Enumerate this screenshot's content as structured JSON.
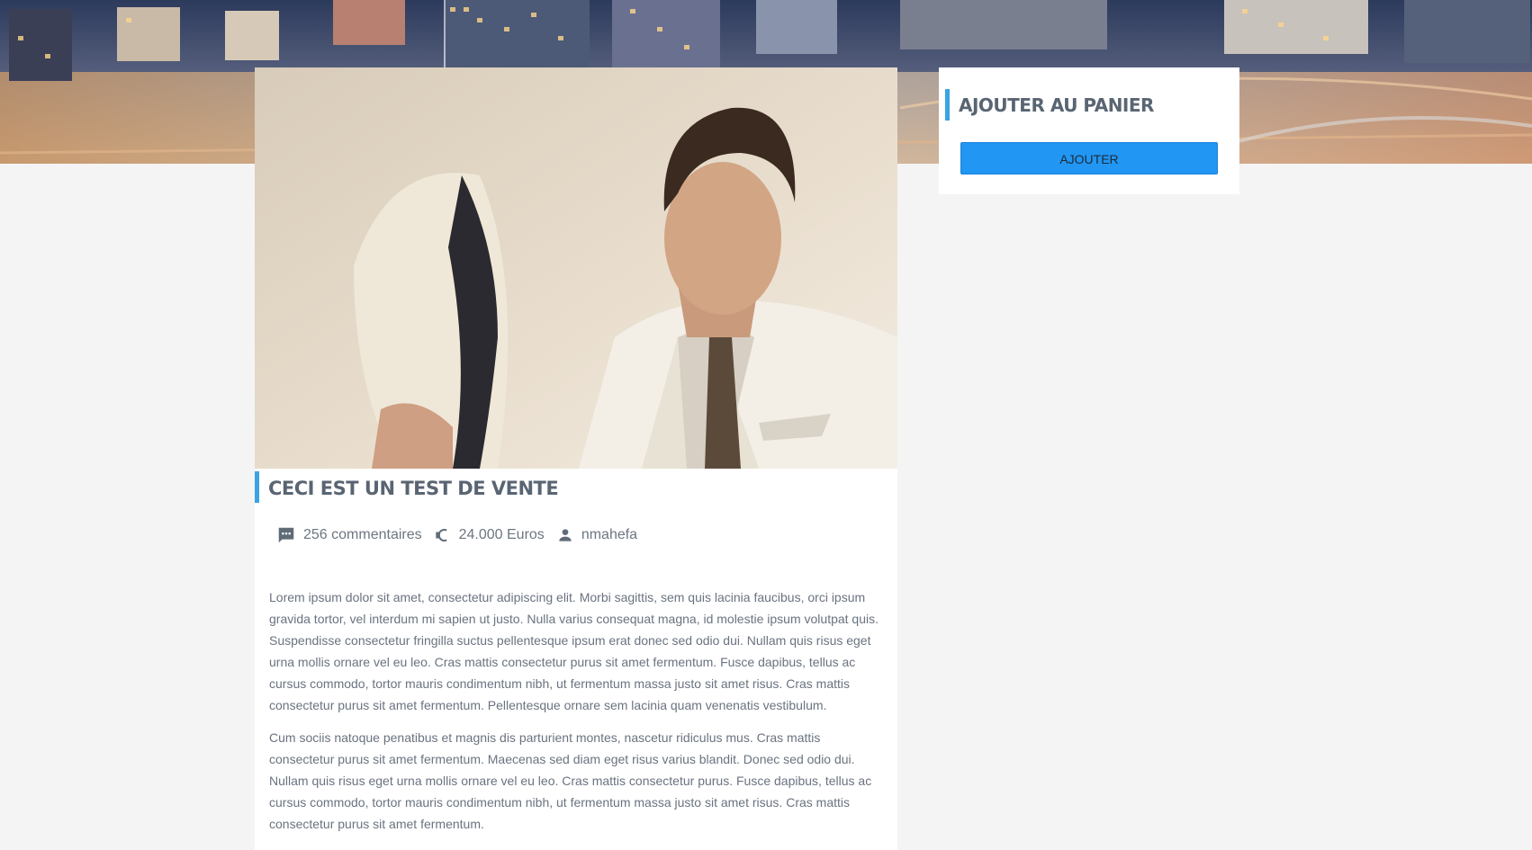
{
  "post": {
    "title": "CECI EST UN TEST DE VENTE",
    "comments": "256 commentaires",
    "price": "24.000 Euros",
    "author": "nmahefa",
    "paragraphs": [
      "Lorem ipsum dolor sit amet, consectetur adipiscing elit. Morbi sagittis, sem quis lacinia faucibus, orci ipsum gravida tortor, vel interdum mi sapien ut justo. Nulla varius consequat magna, id molestie ipsum volutpat quis. Suspendisse consectetur fringilla suctus pellentesque ipsum erat donec sed odio dui. Nullam quis risus eget urna mollis ornare vel eu leo. Cras mattis consectetur purus sit amet fermentum. Fusce dapibus, tellus ac cursus commodo, tortor mauris condimentum nibh, ut fermentum massa justo sit amet risus. Cras mattis consectetur purus sit amet fermentum. Pellentesque ornare sem lacinia quam venenatis vestibulum.",
      "Cum sociis natoque penatibus et magnis dis parturient montes, nascetur ridiculus mus. Cras mattis consectetur purus sit amet fermentum. Maecenas sed diam eget risus varius blandit. Donec sed odio dui. Nullam quis risus eget urna mollis ornare vel eu leo. Cras mattis consectetur purus. Fusce dapibus, tellus ac cursus commodo, tortor mauris condimentum nibh, ut fermentum massa justo sit amet risus. Cras mattis consectetur purus sit amet fermentum."
    ]
  },
  "sidebar": {
    "title": "AJOUTER AU PANIER",
    "button_label": "AJOUTER"
  },
  "icons": {
    "comments": "comment-icon",
    "price": "euro-icon",
    "author": "person-icon"
  },
  "colors": {
    "accent": "#3aa3e3",
    "button": "#2196f3",
    "page_bg": "#f4f4f4"
  }
}
